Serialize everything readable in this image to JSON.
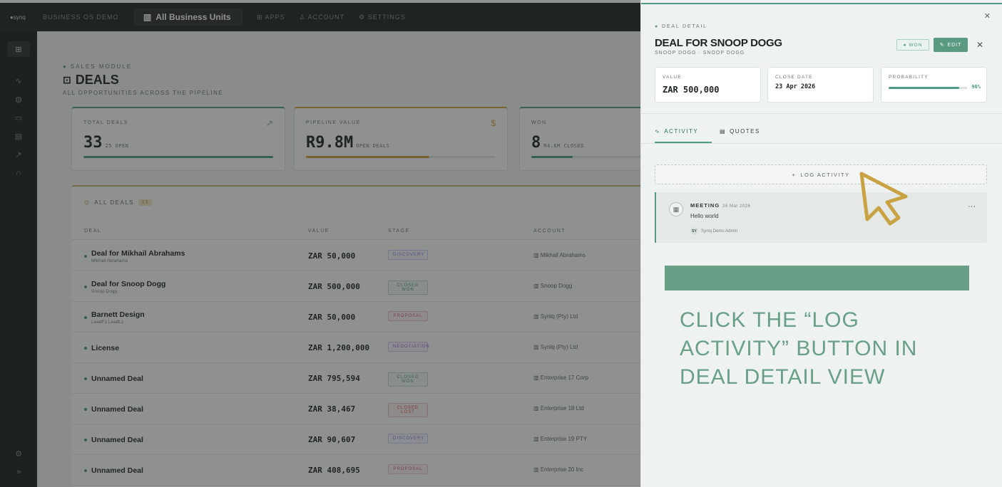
{
  "topbar": {
    "logo": "●synq",
    "business": "BUSINESS OS DEMO",
    "business_unit": "All Business Units",
    "nav": [
      "APPS",
      "ACCOUNT",
      "SETTINGS"
    ]
  },
  "page": {
    "kicker": "SALES MODULE",
    "title": "DEALS",
    "subtitle": "ALL OPPORTUNITIES ACROSS THE PIPELINE"
  },
  "stats": [
    {
      "label": "TOTAL DEALS",
      "value": "33",
      "sub": "25 OPEN",
      "accent": "#4f9a88",
      "fill": 1.0
    },
    {
      "label": "PIPELINE VALUE",
      "value": "R9.8M",
      "sub": "OPEN DEALS",
      "accent": "#d1a13c",
      "fill": 0.65
    },
    {
      "label": "WON",
      "value": "8",
      "sub": "R4.6M CLOSED",
      "accent": "#4f9a88",
      "fill": 0.35
    }
  ],
  "table": {
    "title": "ALL DEALS",
    "count": "33",
    "headers": [
      "DEAL",
      "VALUE",
      "STAGE",
      "ACCOUNT"
    ],
    "rows": [
      {
        "name": "Deal for Mikhail Abrahams",
        "contact": "Mikhail Abrahams",
        "value": "ZAR 50,000",
        "stage": "DISCOVERY",
        "stage_color": "#7a7fd6",
        "account": "Mikhail Abrahams"
      },
      {
        "name": "Deal for Snoop Dogg",
        "contact": "Snoop Dogg",
        "value": "ZAR 500,000",
        "stage": "CLOSED WON",
        "stage_color": "#4f9a7e",
        "account": "Snoop Dogg"
      },
      {
        "name": "Barnett Design",
        "contact": "LeadF1 LeadL1",
        "value": "ZAR 50,000",
        "stage": "PROPOSAL",
        "stage_color": "#d6587a",
        "account": "Synlq (Pty) Ltd"
      },
      {
        "name": "License",
        "contact": "",
        "value": "ZAR 1,200,000",
        "stage": "NEGOTIATION",
        "stage_color": "#a06ad0",
        "account": "Synlq (Pty) Ltd"
      },
      {
        "name": "Unnamed Deal",
        "contact": "",
        "value": "ZAR 795,594",
        "stage": "CLOSED WON",
        "stage_color": "#4f9a7e",
        "account": "Enterprise 17 Corp"
      },
      {
        "name": "Unnamed Deal",
        "contact": "",
        "value": "ZAR 38,467",
        "stage": "CLOSED LOST",
        "stage_color": "#e05050",
        "account": "Enterprise 18 Ltd"
      },
      {
        "name": "Unnamed Deal",
        "contact": "",
        "value": "ZAR 90,607",
        "stage": "DISCOVERY",
        "stage_color": "#7a7fd6",
        "account": "Enterprise 19 PTY"
      },
      {
        "name": "Unnamed Deal",
        "contact": "",
        "value": "ZAR 408,695",
        "stage": "PROPOSAL",
        "stage_color": "#d6587a",
        "account": "Enterprise 20 Inc"
      }
    ]
  },
  "drawer": {
    "kicker": "DEAL DETAIL",
    "title": "DEAL FOR SNOOP DOGG",
    "subtitle": "SNOOP DOGG · SNOOP DOGG",
    "status": "WON",
    "edit": "EDIT",
    "value_label": "VALUE",
    "value": "ZAR 500,000",
    "close_label": "CLOSE DATE",
    "close_date": "23 Apr 2026",
    "prob_label": "PROBABILITY",
    "probability": "90%",
    "probability_fraction": 0.9,
    "tabs": [
      "ACTIVITY",
      "QUOTES"
    ],
    "log_activity": "LOG ACTIVITY",
    "activity": {
      "type": "MEETING",
      "date": "26 Mar 2026",
      "text": "Hello world",
      "user_initials": "SY",
      "user": "Synlq Demo Admin"
    }
  },
  "instruction": "CLICK THE “LOG ACTIVITY” BUTTON IN DEAL DETAIL VIEW"
}
